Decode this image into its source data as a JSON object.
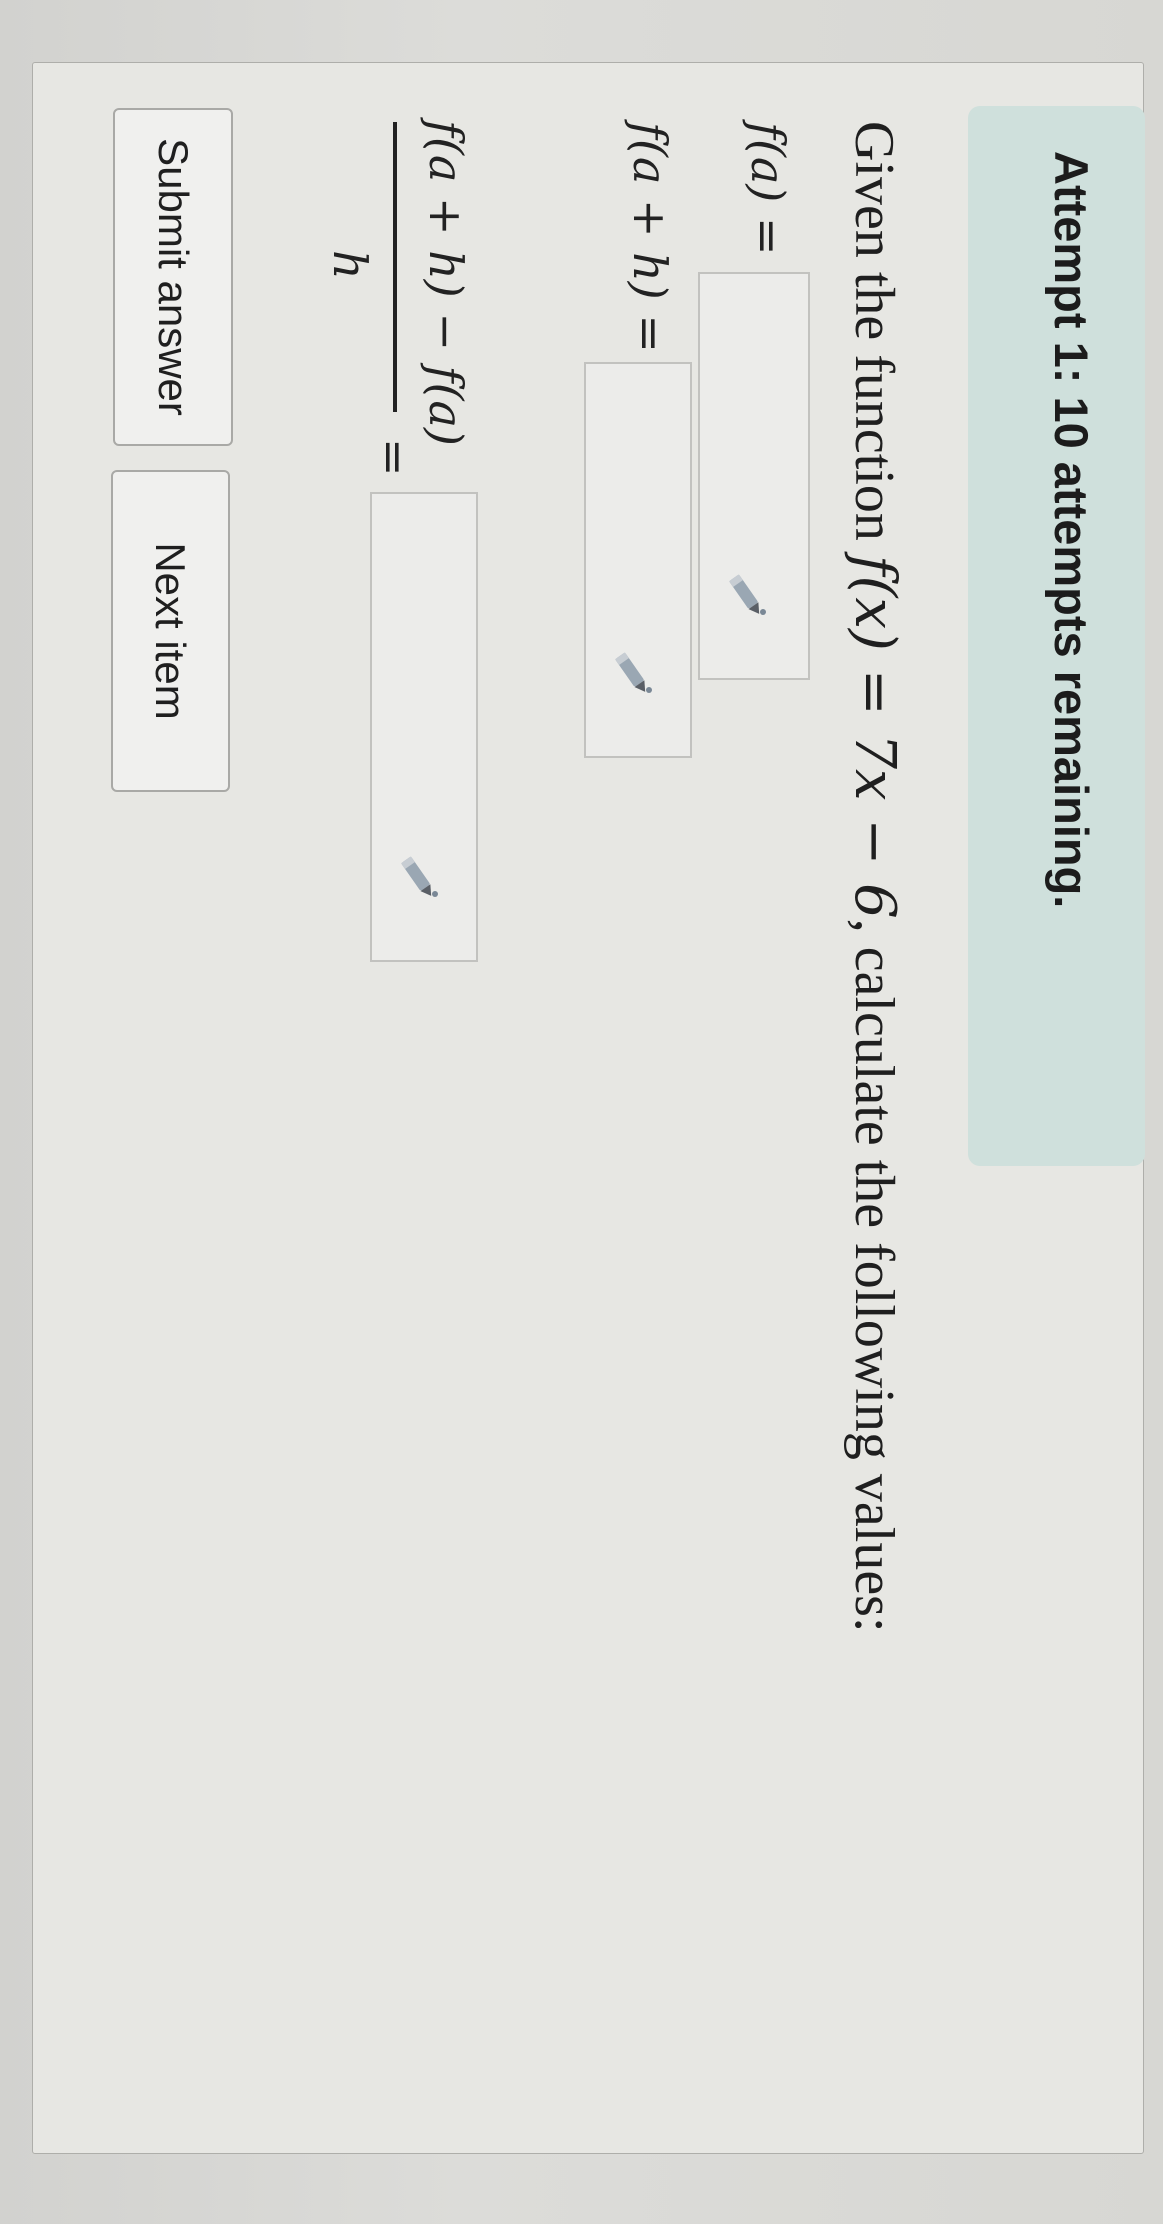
{
  "banner": {
    "text": "Attempt 1: 10 attempts remaining."
  },
  "question": {
    "prompt_before": "Given the function ",
    "function_expr": "f(x) = 7x − 6",
    "prompt_after": ", calculate the following values:"
  },
  "fields": {
    "f_a_label": "f(a) =",
    "f_a_plus_h_label": "f(a + h) =",
    "quotient_numerator": "f(a + h) − f(a)",
    "quotient_denominator": "h",
    "equals": "="
  },
  "icons": {
    "answer_input": "pencil-icon"
  },
  "buttons": {
    "submit": "Submit answer",
    "next": "Next item"
  },
  "colors": {
    "banner_bg": "#cfe0dc",
    "card_bg": "#e7e7e3"
  }
}
